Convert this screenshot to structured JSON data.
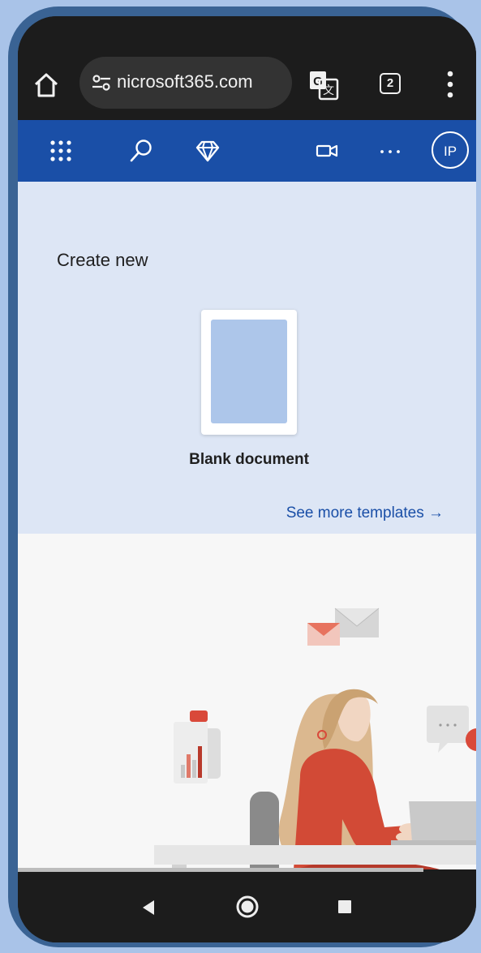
{
  "browser": {
    "url": "microsoft365.com",
    "url_display": "nicrosoft365.com",
    "tab_count": "2",
    "icons": [
      "home-icon",
      "site-settings-icon",
      "translate-icon",
      "tabs-icon",
      "more-vert-icon"
    ]
  },
  "header": {
    "icons": [
      "app-launcher-icon",
      "search-icon",
      "premium-diamond-icon",
      "video-icon",
      "more-horiz-icon"
    ],
    "avatar_initials": "IP",
    "brand_color": "#1a4fa7"
  },
  "create_new": {
    "title": "Create new",
    "blank_document_label": "Blank document",
    "see_more_label": "See more templates →"
  },
  "navbar": {
    "icons": [
      "back-icon",
      "home-circle-icon",
      "recents-icon"
    ]
  }
}
